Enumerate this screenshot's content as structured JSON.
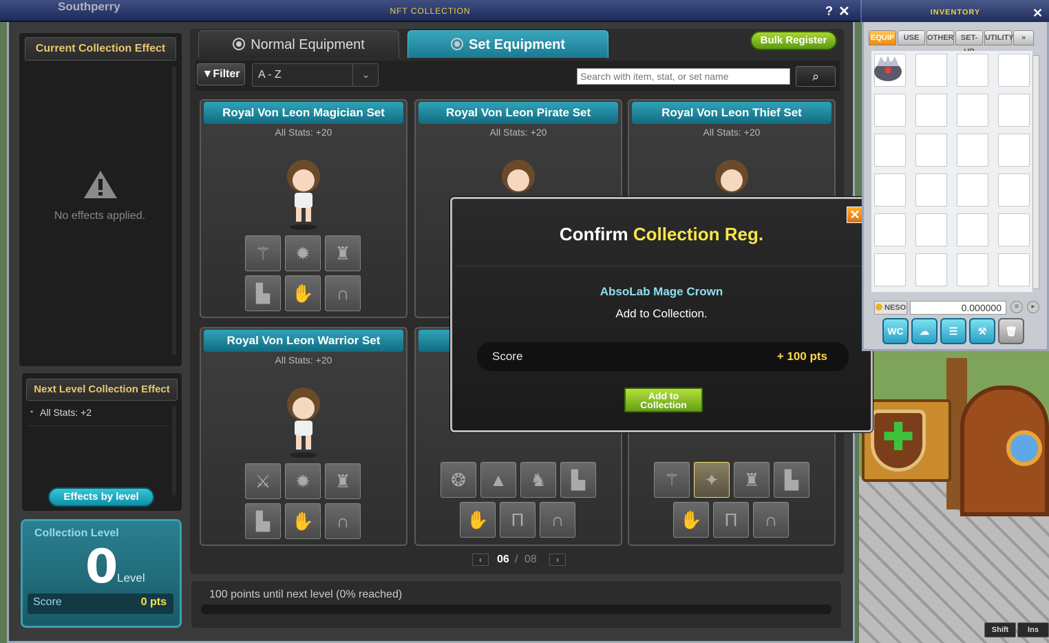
{
  "main_window": {
    "title": "NFT COLLECTION",
    "location_name": "Southperry",
    "help": "?",
    "close": "✕"
  },
  "left_panel": {
    "current_effect_header": "Current Collection Effect",
    "no_effects": "No effects applied.",
    "next_effect_header": "Next Level Collection Effect",
    "next_effect_item": "All Stats: +2",
    "effects_by_level_btn": "Effects by level",
    "collection_level": {
      "title": "Collection Level",
      "value": "0",
      "unit": "Level",
      "score_label": "Score",
      "score_value": "0 pts"
    }
  },
  "tabs": [
    {
      "label": "Normal Equipment",
      "active": false
    },
    {
      "label": "Set Equipment",
      "active": true
    }
  ],
  "bulk_register": "Bulk Register",
  "toolbar": {
    "filter_label": "Filter",
    "sort_value": "A - Z",
    "search_placeholder": "Search with item, stat, or set name"
  },
  "cards": [
    {
      "title": "Royal Von Leon Magician Set",
      "stat": "All Stats: +20"
    },
    {
      "title": "Royal Von Leon Pirate Set",
      "stat": "All Stats: +20"
    },
    {
      "title": "Royal Von Leon Thief Set",
      "stat": "All Stats: +20"
    },
    {
      "title": "Royal Von Leon Warrior Set",
      "stat": "All Stats: +20"
    }
  ],
  "pagination": {
    "current": "06",
    "separator": "/",
    "total": "08"
  },
  "progress": {
    "text": "100 points until next level (0% reached)",
    "fraction": 0
  },
  "modal": {
    "title_plain": "Confirm",
    "title_highlight": "Collection Reg.",
    "item_name": "AbsoLab Mage Crown",
    "message": "Add to Collection.",
    "score_label": "Score",
    "score_value": "+ 100 pts",
    "add_button": "Add to Collection",
    "close": "✕"
  },
  "inventory": {
    "title": "INVENTORY",
    "close": "✕",
    "tabs": [
      "EQUIP",
      "USE",
      "OTHER",
      "SET-UP",
      "UTILITY",
      "»"
    ],
    "meso_label": "NESO",
    "meso_value": "0.000000",
    "buttons": [
      "WC",
      "cloud-icon",
      "list-icon",
      "hammer-icon",
      "trash-icon"
    ]
  },
  "keys": [
    "Shift",
    "Ins"
  ],
  "colors": {
    "accent_teal": "#1a7a92",
    "highlight_yellow": "#f8e64a",
    "button_green": "#64a018"
  }
}
